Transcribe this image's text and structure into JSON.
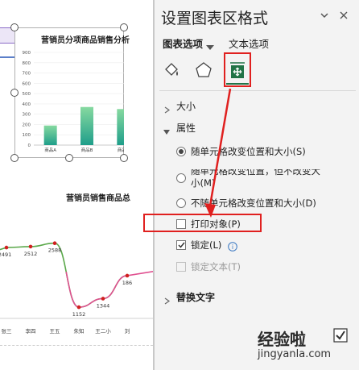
{
  "chart1": {
    "title": "营销员分项商品销售分析",
    "y_ticks": [
      "900",
      "800",
      "700",
      "600",
      "500",
      "400",
      "300",
      "200",
      "100",
      "0"
    ],
    "bars": [
      {
        "label": "商品A",
        "value": 190
      },
      {
        "label": "商品B",
        "value": 370
      },
      {
        "label": "商品C",
        "value": 350
      }
    ],
    "ylim": [
      0,
      900
    ]
  },
  "chart2": {
    "title": "营销员销售商品总",
    "points": [
      {
        "name": "张三",
        "value": 2491
      },
      {
        "name": "李四",
        "value": 2512
      },
      {
        "name": "王五",
        "value": 2588
      },
      {
        "name": "朱知",
        "value": 1152
      },
      {
        "name": "王二小",
        "value": 1344
      },
      {
        "name": "刘",
        "value": 1860
      }
    ],
    "point_labels": [
      "2491",
      "2512",
      "2588",
      "1152",
      "1344",
      "186"
    ],
    "x_labels": [
      "张三",
      "李四",
      "王五",
      "朱知",
      "王二小",
      "刘"
    ]
  },
  "panel": {
    "title": "设置图表区格式",
    "tab_chart_options": "图表选项",
    "tab_text_options": "文本选项",
    "section_size": "大小",
    "section_properties": "属性",
    "opt_move_and_size": "随单元格改变位置和大小(S)",
    "opt_move_no_size": "随单元格改变位置，但不改变大小(M)",
    "opt_no_move_no_size": "不随单元格改变位置和大小(D)",
    "print_object": "打印对象(P)",
    "locked": "锁定(L)",
    "lock_text": "锁定文本(T)",
    "section_alt_text": "替换文字"
  },
  "watermark": {
    "cn": "经验啦",
    "url": "jingyanla.com"
  },
  "colors": {
    "highlight_red": "#e0201f",
    "bar_top": "#86d9a0",
    "bar_bottom": "#1f9e8a",
    "icon_green": "#217346",
    "line_green": "#5aa84a",
    "line_pink": "#e05090",
    "point_red": "#d02020"
  }
}
